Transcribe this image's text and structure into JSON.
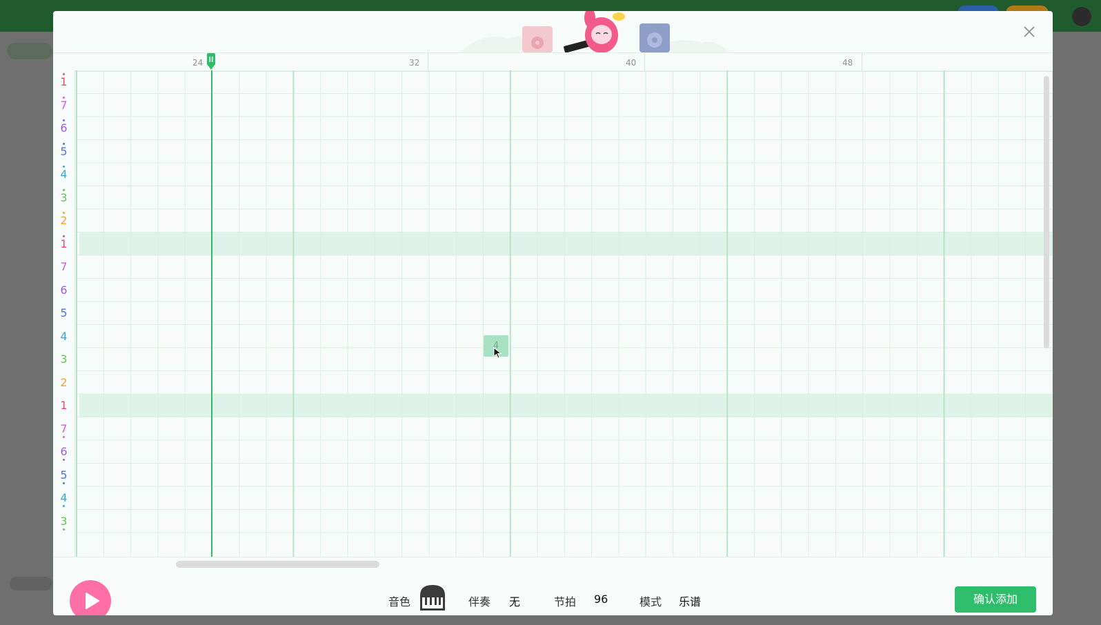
{
  "editor": {
    "ruler_labels": [
      "24",
      "32",
      "40",
      "48"
    ],
    "pitch_rows": [
      {
        "label": "1",
        "octave": "high",
        "color": "#e84c6f"
      },
      {
        "label": "7",
        "octave": "high",
        "color": "#d15fd8"
      },
      {
        "label": "6",
        "octave": "high",
        "color": "#9b5de5"
      },
      {
        "label": "5",
        "octave": "high",
        "color": "#4a78d8"
      },
      {
        "label": "4",
        "octave": "high",
        "color": "#3aa7e0"
      },
      {
        "label": "3",
        "octave": "high",
        "color": "#66c25a"
      },
      {
        "label": "2",
        "octave": "high",
        "color": "#f2a03a"
      },
      {
        "label": "1",
        "octave": "high",
        "color": "#e84c6f"
      },
      {
        "label": "7",
        "octave": "mid",
        "color": "#d15fd8"
      },
      {
        "label": "6",
        "octave": "mid",
        "color": "#9b5de5"
      },
      {
        "label": "5",
        "octave": "mid",
        "color": "#4a78d8"
      },
      {
        "label": "4",
        "octave": "mid",
        "color": "#3aa7e0"
      },
      {
        "label": "3",
        "octave": "mid",
        "color": "#66c25a"
      },
      {
        "label": "2",
        "octave": "mid",
        "color": "#f2a03a"
      },
      {
        "label": "1",
        "octave": "mid",
        "color": "#e84c6f"
      },
      {
        "label": "7",
        "octave": "low",
        "color": "#d15fd8"
      },
      {
        "label": "6",
        "octave": "low",
        "color": "#9b5de5"
      },
      {
        "label": "5",
        "octave": "low",
        "color": "#4a78d8"
      },
      {
        "label": "4",
        "octave": "low",
        "color": "#3aa7e0"
      },
      {
        "label": "3",
        "octave": "low",
        "color": "#66c25a"
      }
    ],
    "note": {
      "label": "4"
    }
  },
  "toolbar": {
    "timbre_label": "音色",
    "accompaniment_label": "伴奏",
    "accompaniment_value": "无",
    "tempo_label": "节拍",
    "tempo_value": "96",
    "mode_label": "模式",
    "mode_value": "乐谱",
    "confirm_label": "确认添加"
  },
  "colors": {
    "accent": "#2ebd6b",
    "play": "#ff6fa5",
    "highlight_row": "#dff4e8",
    "grid_line": "#d3eedf"
  }
}
